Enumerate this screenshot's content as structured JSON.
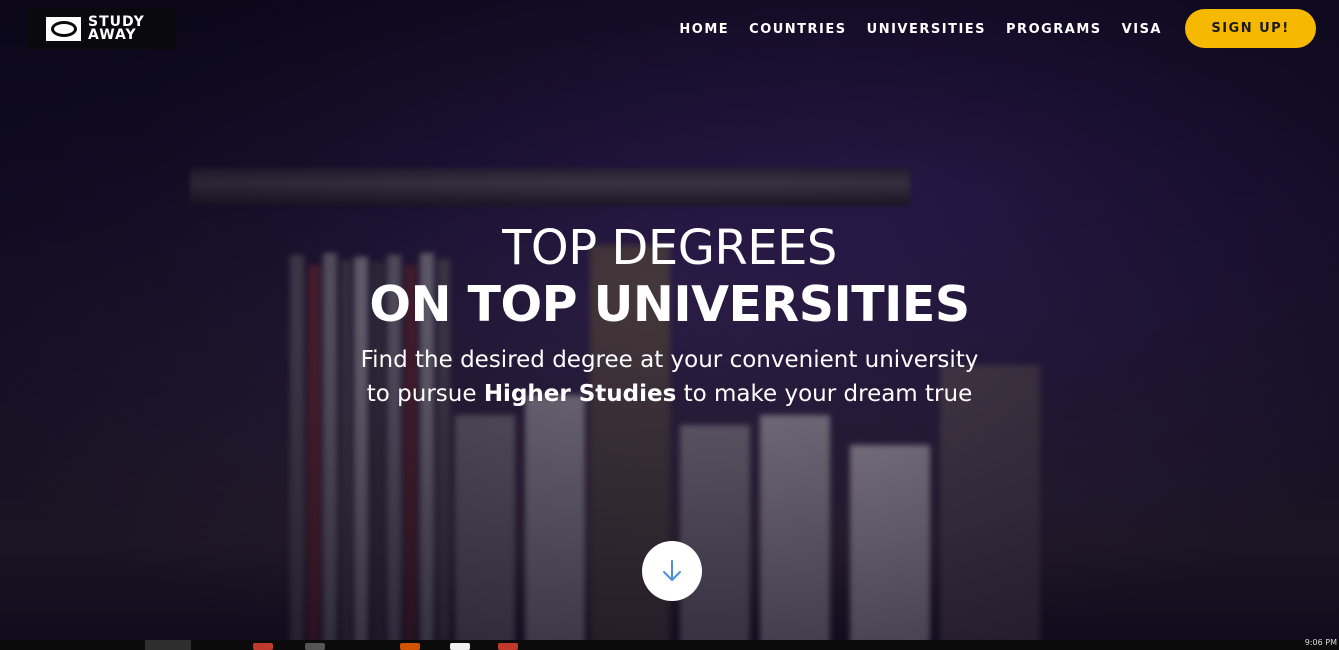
{
  "brand": {
    "line1": "STUDY",
    "line2": "AWAY"
  },
  "nav": {
    "items": [
      "HOME",
      "COUNTRIES",
      "UNIVERSITIES",
      "PROGRAMS",
      "VISA"
    ]
  },
  "signup_label": "SIGN UP!",
  "hero": {
    "headline_line1": "TOP DEGREES",
    "headline_line2": "ON TOP UNIVERSITIES",
    "subtitle_line1": "Find the desired degree at your convenient university",
    "subtitle_prefix": "to pursue",
    "subtitle_bold": "Higher Studies",
    "subtitle_suffix": "to make your dream true"
  },
  "icons": {
    "scroll": "arrow-down-icon",
    "logo": "study-away-logo-icon"
  },
  "colors": {
    "accent": "#f7b900",
    "scroll_arrow": "#4a90d9",
    "text": "#ffffff"
  },
  "taskbar": {
    "clock": "9:06 PM"
  }
}
